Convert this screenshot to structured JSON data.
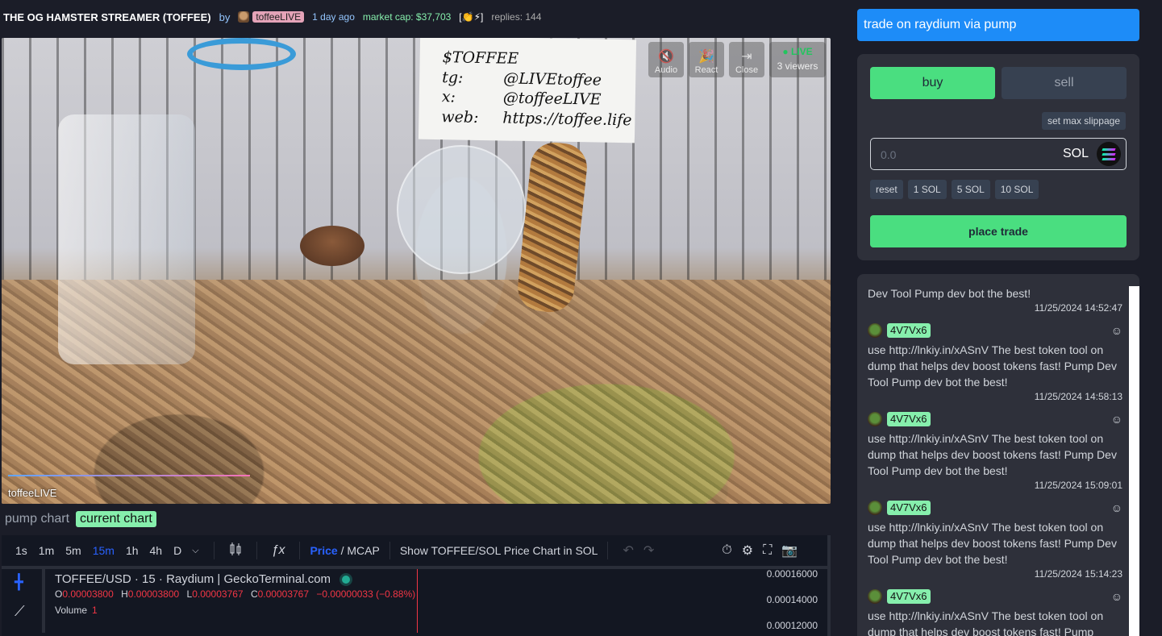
{
  "header": {
    "title": "THE OG HAMSTER STREAMER (TOFFEE)",
    "by": "by",
    "creator": "toffeeLIVE",
    "time": "1 day ago",
    "market_cap": "market cap: $37,703",
    "emojis": "[👏⚡]",
    "replies": "replies: 144"
  },
  "video": {
    "card": {
      "ticker": "$TOFFEE",
      "rows": [
        {
          "label": "tg:",
          "value": "@LIVEtoffee"
        },
        {
          "label": "x:",
          "value": "@toffeeLIVE"
        },
        {
          "label": "web:",
          "value": "https://toffee.life"
        }
      ]
    },
    "controls": {
      "audio": "Audio",
      "react": "React",
      "close": "Close"
    },
    "live": "● LIVE",
    "viewers": "3 viewers",
    "stream_name": "toffeeLIVE"
  },
  "chart_tabs": {
    "pump": "pump chart",
    "current": "current chart"
  },
  "chart_toolbar": {
    "timeframes": [
      "1s",
      "1m",
      "5m",
      "15m",
      "1h",
      "4h",
      "D"
    ],
    "active_timeframe": "15m",
    "price": "Price",
    "mcap": " / MCAP",
    "show_sol": "Show TOFFEE/SOL Price Chart in SOL"
  },
  "chart_legend": {
    "pair": "TOFFEE/USD · 15 · Raydium | GeckoTerminal.com",
    "o": "0.00003800",
    "h": "0.00003800",
    "l": "0.00003767",
    "c": "0.00003767",
    "change": "−0.00000033 (−0.88%)",
    "volume_label": "Volume",
    "volume_value": "1"
  },
  "chart_data": {
    "type": "table",
    "y_ticks": [
      "0.00016000",
      "0.00014000",
      "0.00012000"
    ]
  },
  "trade": {
    "raydium_banner": "trade on raydium via pump",
    "buy": "buy",
    "sell": "sell",
    "slippage": "set max slippage",
    "amount_placeholder": "0.0",
    "currency": "SOL",
    "quick": [
      "reset",
      "1 SOL",
      "5 SOL",
      "10 SOL"
    ],
    "place": "place trade"
  },
  "replies": {
    "first": {
      "text": "Dev Tool Pump dev bot the best!",
      "time": "11/25/2024 14:52:47"
    },
    "items": [
      {
        "user": "4V7Vx6",
        "text": "use http://lnkiy.in/xASnV The best token tool on dump that helps dev boost tokens fast! Pump Dev Tool Pump dev bot the best!",
        "time": "11/25/2024 14:58:13"
      },
      {
        "user": "4V7Vx6",
        "text": "use http://lnkiy.in/xASnV The best token tool on dump that helps dev boost tokens fast! Pump Dev Tool Pump dev bot the best!",
        "time": "11/25/2024 15:09:01"
      },
      {
        "user": "4V7Vx6",
        "text": "use http://lnkiy.in/xASnV The best token tool on dump that helps dev boost tokens fast! Pump Dev Tool Pump dev bot the best!",
        "time": "11/25/2024 15:14:23"
      },
      {
        "user": "4V7Vx6",
        "text": "use http://lnkiy.in/xASnV The best token tool on dump that helps dev boost tokens fast! Pump",
        "time": ""
      }
    ]
  }
}
